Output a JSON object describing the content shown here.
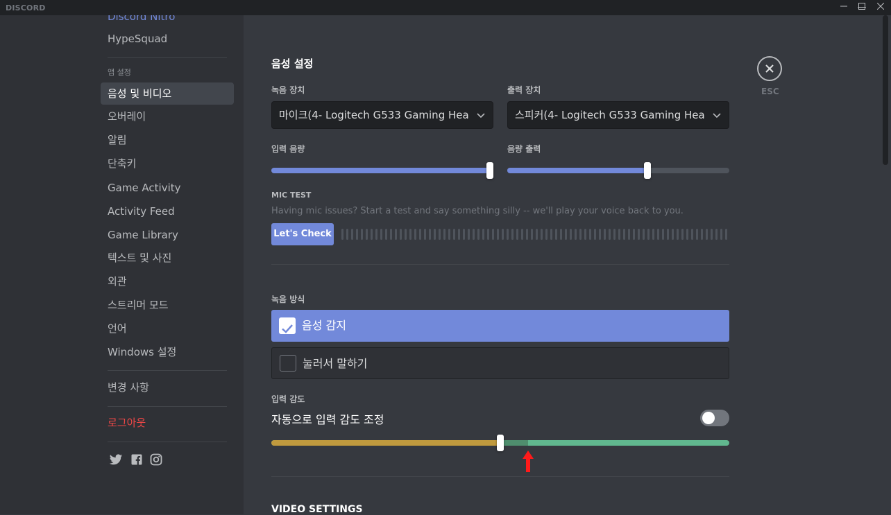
{
  "app": {
    "logo_text": "DISCORD",
    "window_controls": {
      "minimize": "—",
      "maximize": "☐",
      "close": "✕"
    }
  },
  "sidebar": {
    "nitro_label": "Discord Nitro",
    "hypesquad_label": "HypeSquad",
    "app_settings_header": "앱 설정",
    "items": [
      {
        "label": "음성 및 비디오",
        "active": true
      },
      {
        "label": "오버레이"
      },
      {
        "label": "알림"
      },
      {
        "label": "단축키"
      },
      {
        "label": "Game Activity"
      },
      {
        "label": "Activity Feed"
      },
      {
        "label": "Game Library"
      },
      {
        "label": "텍스트 및 사진"
      },
      {
        "label": "외관"
      },
      {
        "label": "스트리머 모드"
      },
      {
        "label": "언어"
      },
      {
        "label": "Windows 설정"
      }
    ],
    "changelog_label": "변경 사항",
    "logout_label": "로그아웃",
    "social_icons": [
      "twitter-icon",
      "facebook-icon",
      "instagram-icon"
    ]
  },
  "voice": {
    "title": "음성 설정",
    "input_device_label": "녹음 장치",
    "input_device_value": "마이크(4- Logitech G533 Gaming Hea",
    "output_device_label": "출력 장치",
    "output_device_value": "스피커(4- Logitech G533 Gaming Hea",
    "input_volume_label": "입력 음량",
    "input_volume_percent": 100,
    "output_volume_label": "음량 출력",
    "output_volume_percent": 63,
    "mic_test_label": "MIC TEST",
    "mic_test_desc": "Having mic issues? Start a test and say something silly -- we'll play your voice back to you.",
    "mic_test_button": "Let's Check",
    "input_mode_label": "녹음 방식",
    "voice_activity_label": "음성 감지",
    "voice_activity_checked": true,
    "push_to_talk_label": "눌러서 말하기",
    "push_to_talk_checked": false,
    "sensitivity_label": "입력 감도",
    "auto_sensitivity_label": "자동으로 입력 감도 조정",
    "auto_sensitivity_on": false,
    "sensitivity_percent": 50
  },
  "video": {
    "title": "VIDEO SETTINGS"
  },
  "esc_label": "ESC",
  "colors": {
    "accent": "#7289da",
    "logout": "#f04747",
    "sensitivity_below": "#c09a3e",
    "sensitivity_above": "#61b88f",
    "sensitivity_active": "#4f8e6e",
    "annotation_arrow": "#ff1a1a"
  }
}
